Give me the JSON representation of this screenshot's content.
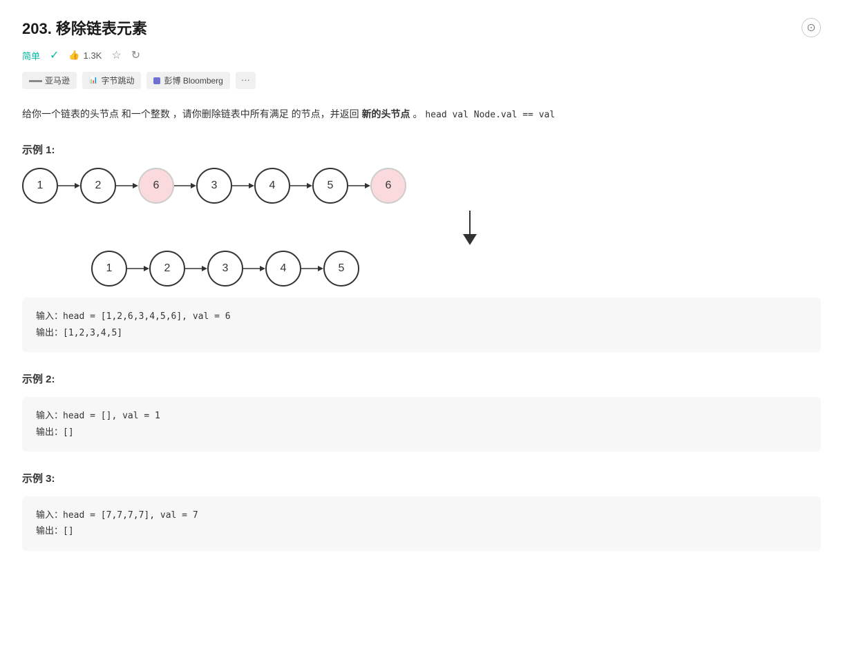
{
  "page": {
    "title": "203. 移除链表元素",
    "difficulty": "简单",
    "likes": "1.3K",
    "tags": [
      {
        "label": "亚马逊",
        "color": "#888",
        "style": "text"
      },
      {
        "label": "字节跳动",
        "color": "#4a6cf7",
        "style": "bar"
      },
      {
        "label": "彭博 Bloomberg",
        "color": "#6464c8",
        "style": "square"
      }
    ],
    "more_tag": "...",
    "description_parts": [
      "给你一个链表的头节点 和一个整数 ，请你删除链表中所有满足 的节点，并返回 ",
      "新的头节点",
      " 。",
      " head val Node.val == val"
    ],
    "desc_text": "给你一个链表的头节点 和一个整数 ，请你删除链表中所有满足 的节点，并返回 新的头节点 。 head val Node.val == val",
    "example1_title": "示例 1:",
    "example1_list1": [
      1,
      2,
      6,
      3,
      4,
      5,
      6
    ],
    "example1_highlighted": [
      6
    ],
    "example1_list2": [
      1,
      2,
      3,
      4,
      5
    ],
    "example1_input": "输入：head = [1,2,6,3,4,5,6], val = 6",
    "example1_output": "输出：[1,2,3,4,5]",
    "example2_title": "示例 2:",
    "example2_input": "输入：head = [], val = 1",
    "example2_output": "输出：[]",
    "example3_title": "示例 3:",
    "example3_input": "输入：head = [7,7,7,7], val = 7",
    "example3_output": "输出：[]"
  }
}
